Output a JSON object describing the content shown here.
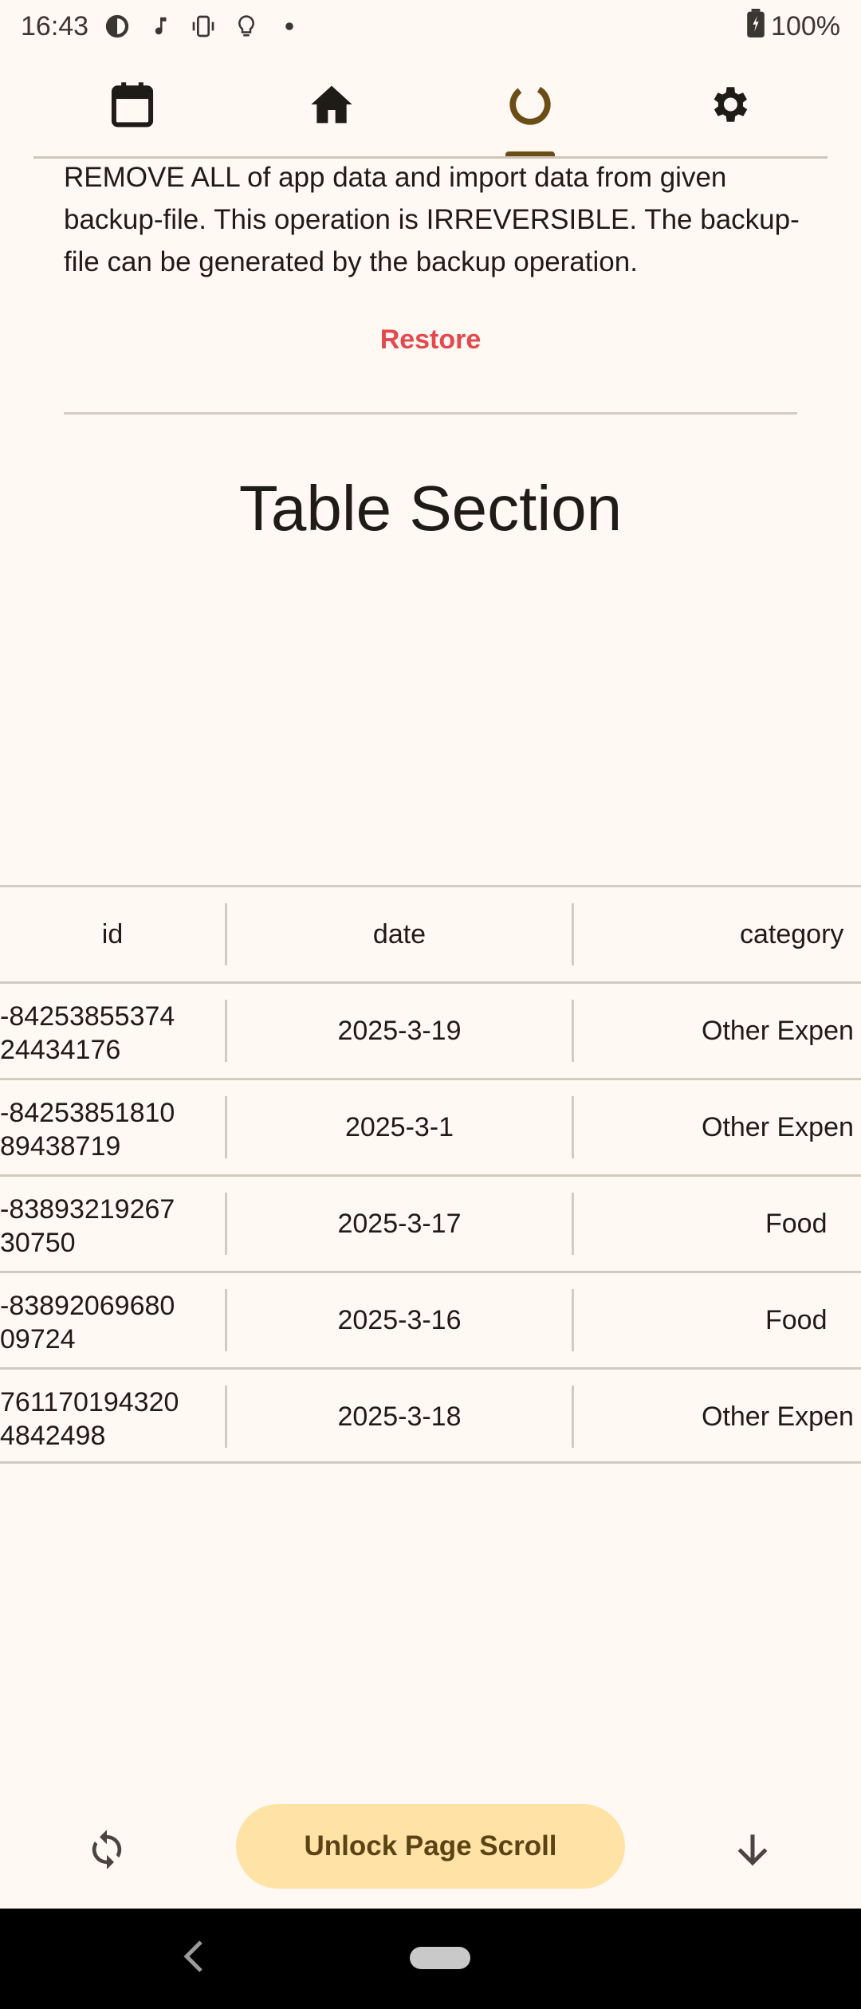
{
  "status_bar": {
    "time": "16:43",
    "battery": "100%",
    "icons": [
      "pie-status-icon",
      "music-note-icon",
      "vibrate-icon",
      "lightbulb-icon",
      "dot-icon"
    ]
  },
  "top_nav": {
    "tabs": [
      {
        "name": "calendar",
        "icon": "calendar-icon"
      },
      {
        "name": "home",
        "icon": "home-icon"
      },
      {
        "name": "stats",
        "icon": "loading-ring-icon",
        "selected": true
      },
      {
        "name": "settings",
        "icon": "gear-icon"
      }
    ]
  },
  "restore_section": {
    "description": "REMOVE ALL of app data and import data from given backup-file. This operation is IRREVERSIBLE. The backup-file can be generated by the backup operation.",
    "button_label": "Restore"
  },
  "table_section": {
    "title": "Table Section",
    "columns": [
      "id",
      "date",
      "category"
    ],
    "rows": [
      {
        "id": "-84253855374\n24434176",
        "date": "2025-3-19",
        "category": "Other Expen"
      },
      {
        "id": "-84253851810\n89438719",
        "date": "2025-3-1",
        "category": "Other Expen"
      },
      {
        "id": "-83893219267\n30750",
        "date": "2025-3-17",
        "category": "Food"
      },
      {
        "id": "-83892069680\n09724",
        "date": "2025-3-16",
        "category": "Food"
      },
      {
        "id": "761170194320\n4842498",
        "date": "2025-3-18",
        "category": "Other Expen"
      }
    ]
  },
  "bottom_bar": {
    "unlock_label": "Unlock Page Scroll"
  },
  "colors": {
    "background": "#FFF8F3",
    "accent": "#6B4E16",
    "restore": "#E5484D",
    "unlock_bg": "#FFE3A6"
  }
}
